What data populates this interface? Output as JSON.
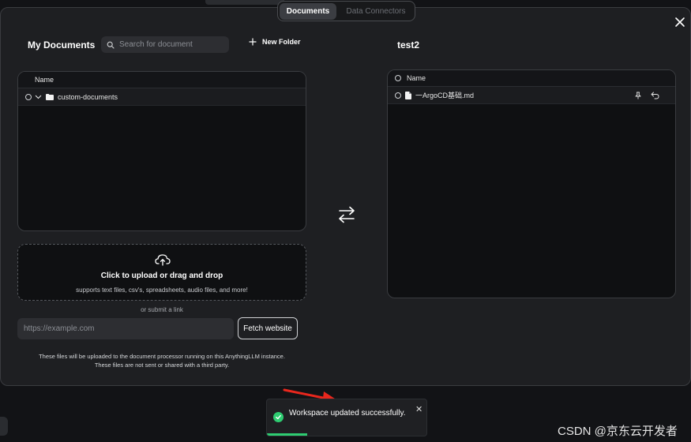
{
  "tabs": [
    {
      "label": "Documents",
      "active": true
    },
    {
      "label": "Data Connectors",
      "active": false
    }
  ],
  "left": {
    "title": "My Documents",
    "search_placeholder": "Search for document",
    "new_folder_label": "New Folder",
    "column_header": "Name",
    "rows": [
      {
        "name": "custom-documents",
        "icon": "folder-icon"
      }
    ]
  },
  "upload": {
    "main_text": "Click to upload or drag and drop",
    "sub_text": "supports text files, csv's, spreadsheets, audio files, and more!",
    "or_text": "or submit a link",
    "url_placeholder": "https://example.com",
    "fetch_label": "Fetch website",
    "note_line1": "These files will be uploaded to the document processor running on this AnythingLLM instance.",
    "note_line2": "These files are not sent or shared with a third party."
  },
  "right": {
    "title": "test2",
    "column_header": "Name",
    "rows": [
      {
        "name": "一ArgoCD基础.md",
        "icon": "file-icon"
      }
    ]
  },
  "toast": {
    "message": "Workspace updated successfully.",
    "progress": 0.25,
    "status_color": "#2ecc71"
  },
  "watermark": "CSDN @京东云开发者",
  "colors": {
    "accent_success": "#2ecc71",
    "annotation_arrow": "#e8271d"
  }
}
